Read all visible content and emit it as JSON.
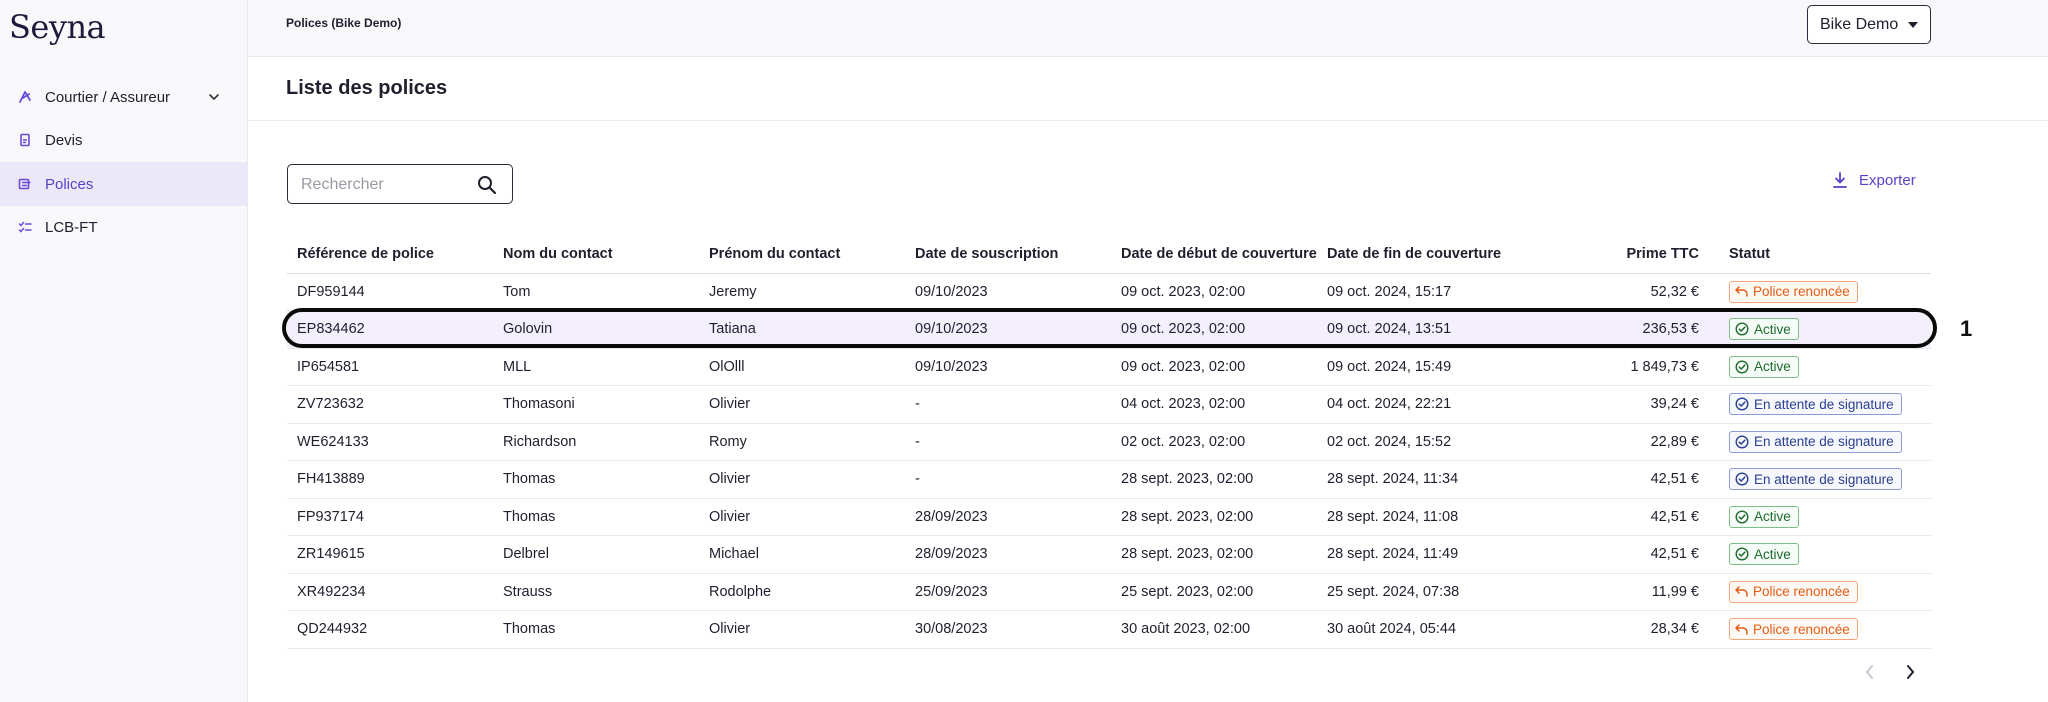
{
  "app": {
    "logo": "Seyna"
  },
  "sidebar": {
    "items": [
      {
        "label": "Courtier / Assureur",
        "icon": "broker-icon",
        "expandable": true
      },
      {
        "label": "Devis",
        "icon": "document-icon"
      },
      {
        "label": "Polices",
        "icon": "policy-icon",
        "active": true
      },
      {
        "label": "LCB-FT",
        "icon": "checklist-icon"
      }
    ]
  },
  "topbar": {
    "title": "Polices (Bike Demo)",
    "demo_select": "Bike Demo"
  },
  "page": {
    "title": "Liste des polices"
  },
  "search": {
    "placeholder": "Rechercher"
  },
  "export": {
    "label": "Exporter"
  },
  "table": {
    "columns": [
      "Référence de police",
      "Nom du contact",
      "Prénom du contact",
      "Date de souscription",
      "Date de début de couverture",
      "Date de fin de couverture",
      "Prime TTC",
      "Statut"
    ],
    "rows": [
      {
        "ref": "DF959144",
        "nom": "Tom",
        "prenom": "Jeremy",
        "souscription": "09/10/2023",
        "debut": "09 oct. 2023, 02:00",
        "fin": "09 oct. 2024, 15:17",
        "prime": "52,32 €",
        "statut": "Police renoncée",
        "statut_type": "renoncee"
      },
      {
        "ref": "EP834462",
        "nom": "Golovin",
        "prenom": "Tatiana",
        "souscription": "09/10/2023",
        "debut": "09 oct. 2023, 02:00",
        "fin": "09 oct. 2024, 13:51",
        "prime": "236,53 €",
        "statut": "Active",
        "statut_type": "active"
      },
      {
        "ref": "IP654581",
        "nom": "MLL",
        "prenom": "OlOlll",
        "souscription": "09/10/2023",
        "debut": "09 oct. 2023, 02:00",
        "fin": "09 oct. 2024, 15:49",
        "prime": "1 849,73 €",
        "statut": "Active",
        "statut_type": "active"
      },
      {
        "ref": "ZV723632",
        "nom": "Thomasoni",
        "prenom": "Olivier",
        "souscription": "-",
        "debut": "04 oct. 2023, 02:00",
        "fin": "04 oct. 2024, 22:21",
        "prime": "39,24 €",
        "statut": "En attente de signature",
        "statut_type": "attente"
      },
      {
        "ref": "WE624133",
        "nom": "Richardson",
        "prenom": "Romy",
        "souscription": "-",
        "debut": "02 oct. 2023, 02:00",
        "fin": "02 oct. 2024, 15:52",
        "prime": "22,89 €",
        "statut": "En attente de signature",
        "statut_type": "attente"
      },
      {
        "ref": "FH413889",
        "nom": "Thomas",
        "prenom": "Olivier",
        "souscription": "-",
        "debut": "28 sept. 2023, 02:00",
        "fin": "28 sept. 2024, 11:34",
        "prime": "42,51 €",
        "statut": "En attente de signature",
        "statut_type": "attente"
      },
      {
        "ref": "FP937174",
        "nom": "Thomas",
        "prenom": "Olivier",
        "souscription": "28/09/2023",
        "debut": "28 sept. 2023, 02:00",
        "fin": "28 sept. 2024, 11:08",
        "prime": "42,51 €",
        "statut": "Active",
        "statut_type": "active"
      },
      {
        "ref": "ZR149615",
        "nom": "Delbrel",
        "prenom": "Michael",
        "souscription": "28/09/2023",
        "debut": "28 sept. 2023, 02:00",
        "fin": "28 sept. 2024, 11:49",
        "prime": "42,51 €",
        "statut": "Active",
        "statut_type": "active"
      },
      {
        "ref": "XR492234",
        "nom": "Strauss",
        "prenom": "Rodolphe",
        "souscription": "25/09/2023",
        "debut": "25 sept. 2023, 02:00",
        "fin": "25 sept. 2024, 07:38",
        "prime": "11,99 €",
        "statut": "Police renoncée",
        "statut_type": "renoncee"
      },
      {
        "ref": "QD244932",
        "nom": "Thomas",
        "prenom": "Olivier",
        "souscription": "30/08/2023",
        "debut": "30 août 2023, 02:00",
        "fin": "30 août 2024, 05:44",
        "prime": "28,34 €",
        "statut": "Police renoncée",
        "statut_type": "renoncee"
      }
    ]
  },
  "annotation": {
    "label": "1",
    "row_index": 1
  },
  "colors": {
    "accent": "#5b3fc8",
    "active": "#1f6b2e",
    "renoncee": "#e35b14",
    "attente": "#2a3f8f"
  }
}
